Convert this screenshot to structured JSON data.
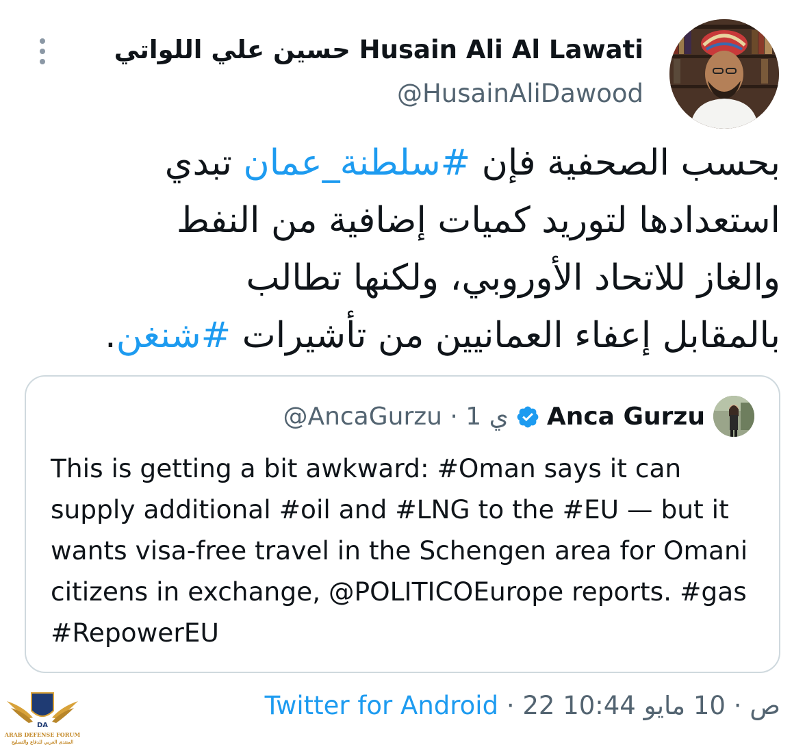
{
  "tweet": {
    "author_name": "حسين علي اللواتي Husain Ali Al Lawati",
    "author_handle": "@HusainAliDawood",
    "text_lines": [
      {
        "parts": [
          {
            "text": "بحسب الصحفية فإن ",
            "hashtag": false
          },
          {
            "text": "#سلطنة_عمان",
            "hashtag": true
          },
          {
            "text": " تبدي",
            "hashtag": false
          }
        ]
      },
      {
        "parts": [
          {
            "text": "استعدادها لتوريد كميات إضافية من النفط",
            "hashtag": false
          }
        ]
      },
      {
        "parts": [
          {
            "text": "والغاز للاتحاد الأوروبي، ولكنها تطالب",
            "hashtag": false
          }
        ]
      },
      {
        "parts": [
          {
            "text": "بالمقابل إعفاء العمانيين من تأشيرات ",
            "hashtag": false
          },
          {
            "text": "#شنغن",
            "hashtag": true
          },
          {
            "text": ".",
            "hashtag": false
          }
        ]
      }
    ],
    "more_icon": "more-vertical-icon"
  },
  "quote": {
    "author_name": "Anca Gurzu",
    "verified_icon": "verified-badge-icon",
    "handle_meta": "@AncaGurzu · 1 ي",
    "text": "This is getting a bit awkward: #Oman says it can supply additional #oil and #LNG  to the #EU — but it wants visa-free travel in the Schengen area for Omani citizens in exchange, @POLITICOEurope reports. #gas #RepowerEU"
  },
  "footer": {
    "source": "Twitter for Android",
    "separator": " · ",
    "timestamp": "22 10:44 ص · 10 مايو"
  },
  "watermark": {
    "line1": "ARAB DEFENSE FORUM",
    "line2": "المنتدى العربي للدفاع والتسليح"
  },
  "colors": {
    "link": "#1d9bf0",
    "secondary_text": "#536471",
    "border": "#cfd9de",
    "primary_text": "#0f1419"
  }
}
